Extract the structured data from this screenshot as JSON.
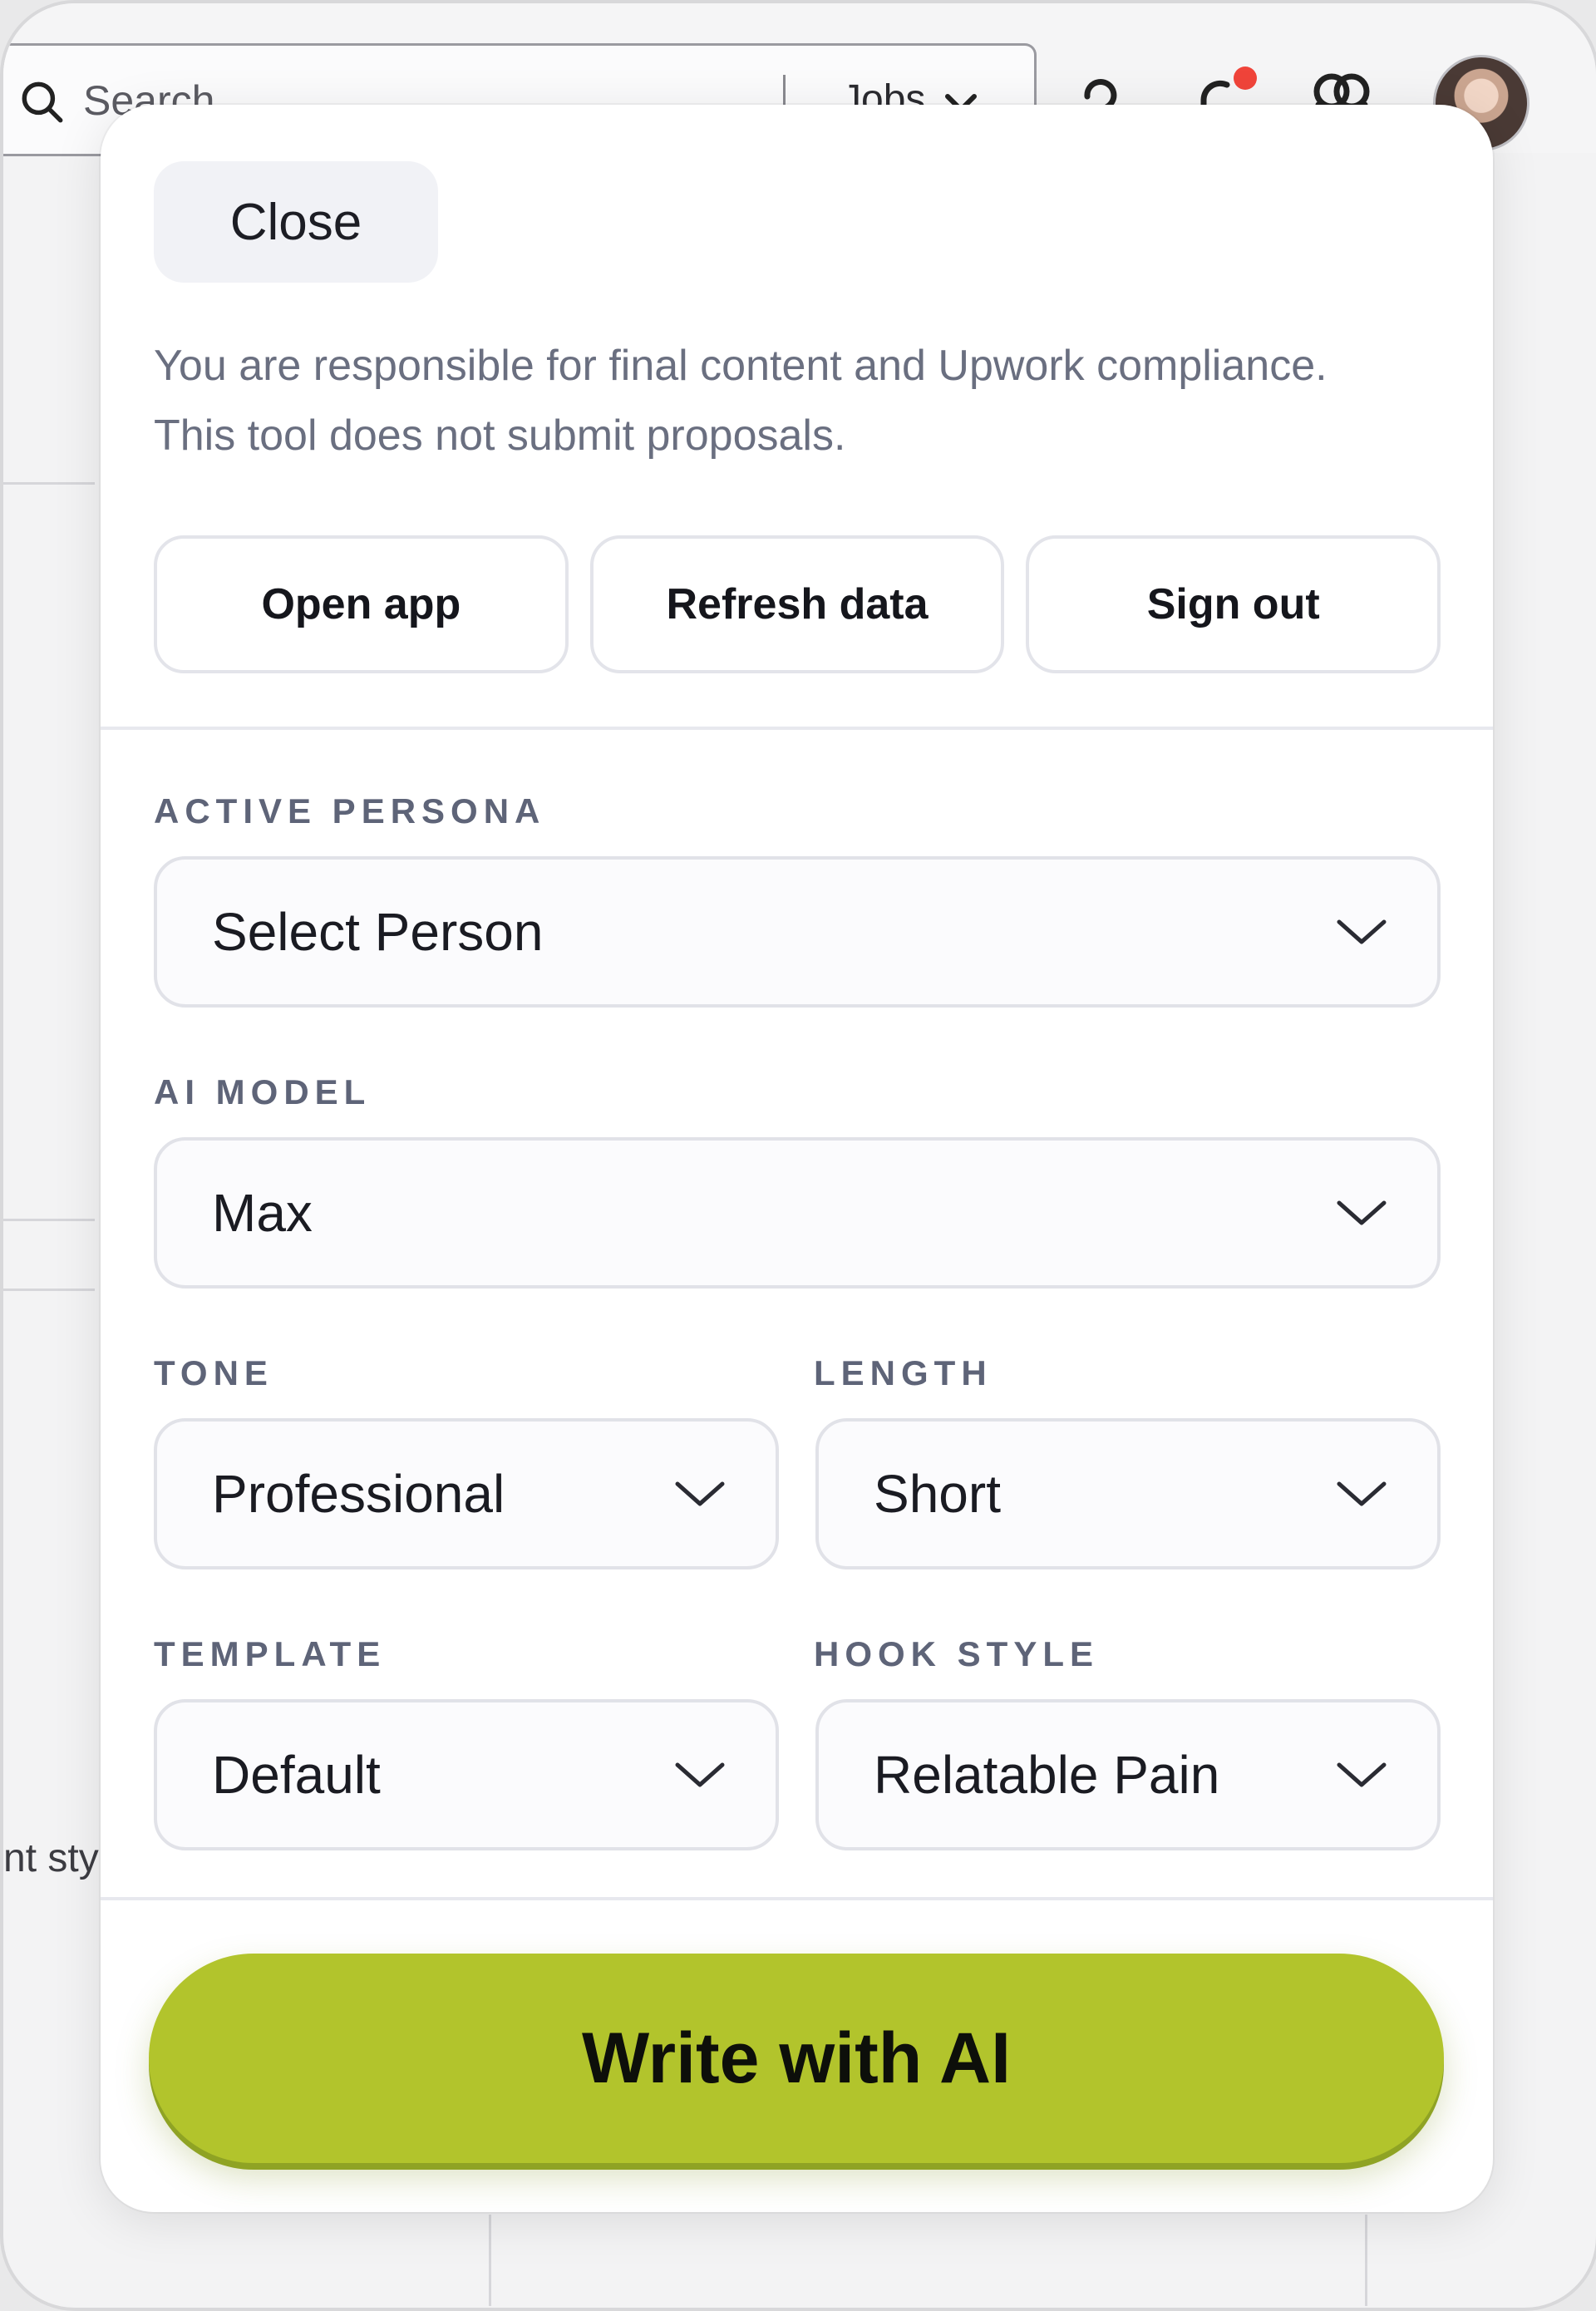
{
  "background": {
    "search_placeholder": "Search",
    "jobs_label": "Jobs",
    "side_text": "nt sty"
  },
  "panel": {
    "close_label": "Close",
    "notice": "You are responsible for final content and Upwork compliance. This tool does not submit proposals.",
    "actions": {
      "open_app": "Open app",
      "refresh_data": "Refresh data",
      "sign_out": "Sign out"
    },
    "fields": {
      "active_persona": {
        "label": "ACTIVE PERSONA",
        "value": "Select Person"
      },
      "ai_model": {
        "label": "AI MODEL",
        "value": "Max"
      },
      "tone": {
        "label": "TONE",
        "value": "Professional"
      },
      "length": {
        "label": "LENGTH",
        "value": "Short"
      },
      "template": {
        "label": "TEMPLATE",
        "value": "Default"
      },
      "hook_style": {
        "label": "HOOK STYLE",
        "value": "Relatable Pain"
      }
    },
    "primary_button": "Write with AI"
  },
  "colors": {
    "accent": "#b2c42c",
    "notification_dot": "#f0443a",
    "label_gray": "#5e6478"
  }
}
